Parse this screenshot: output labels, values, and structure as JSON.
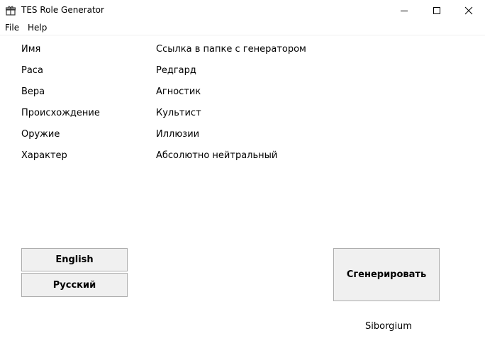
{
  "window": {
    "title": "TES Role Generator",
    "icon": "gift-icon",
    "controls": [
      "minimize-icon",
      "maximize-icon",
      "close-icon"
    ]
  },
  "menu": {
    "file": "File",
    "help": "Help"
  },
  "fields": [
    {
      "label": "Имя",
      "value": "Ссылка в папке с генератором"
    },
    {
      "label": "Раса",
      "value": "Редгард"
    },
    {
      "label": "Вера",
      "value": "Агностик"
    },
    {
      "label": "Происхождение",
      "value": "Культист"
    },
    {
      "label": "Оружие",
      "value": "Иллюзии"
    },
    {
      "label": "Характер",
      "value": "Абсолютно нейтральный"
    }
  ],
  "buttons": {
    "english": "English",
    "russian": "Русский",
    "generate": "Сгенерировать"
  },
  "footer": {
    "author": "Siborgium"
  },
  "colors": {
    "button_bg": "#f0f0f0",
    "button_border": "#adadad",
    "window_bg": "#ffffff"
  }
}
